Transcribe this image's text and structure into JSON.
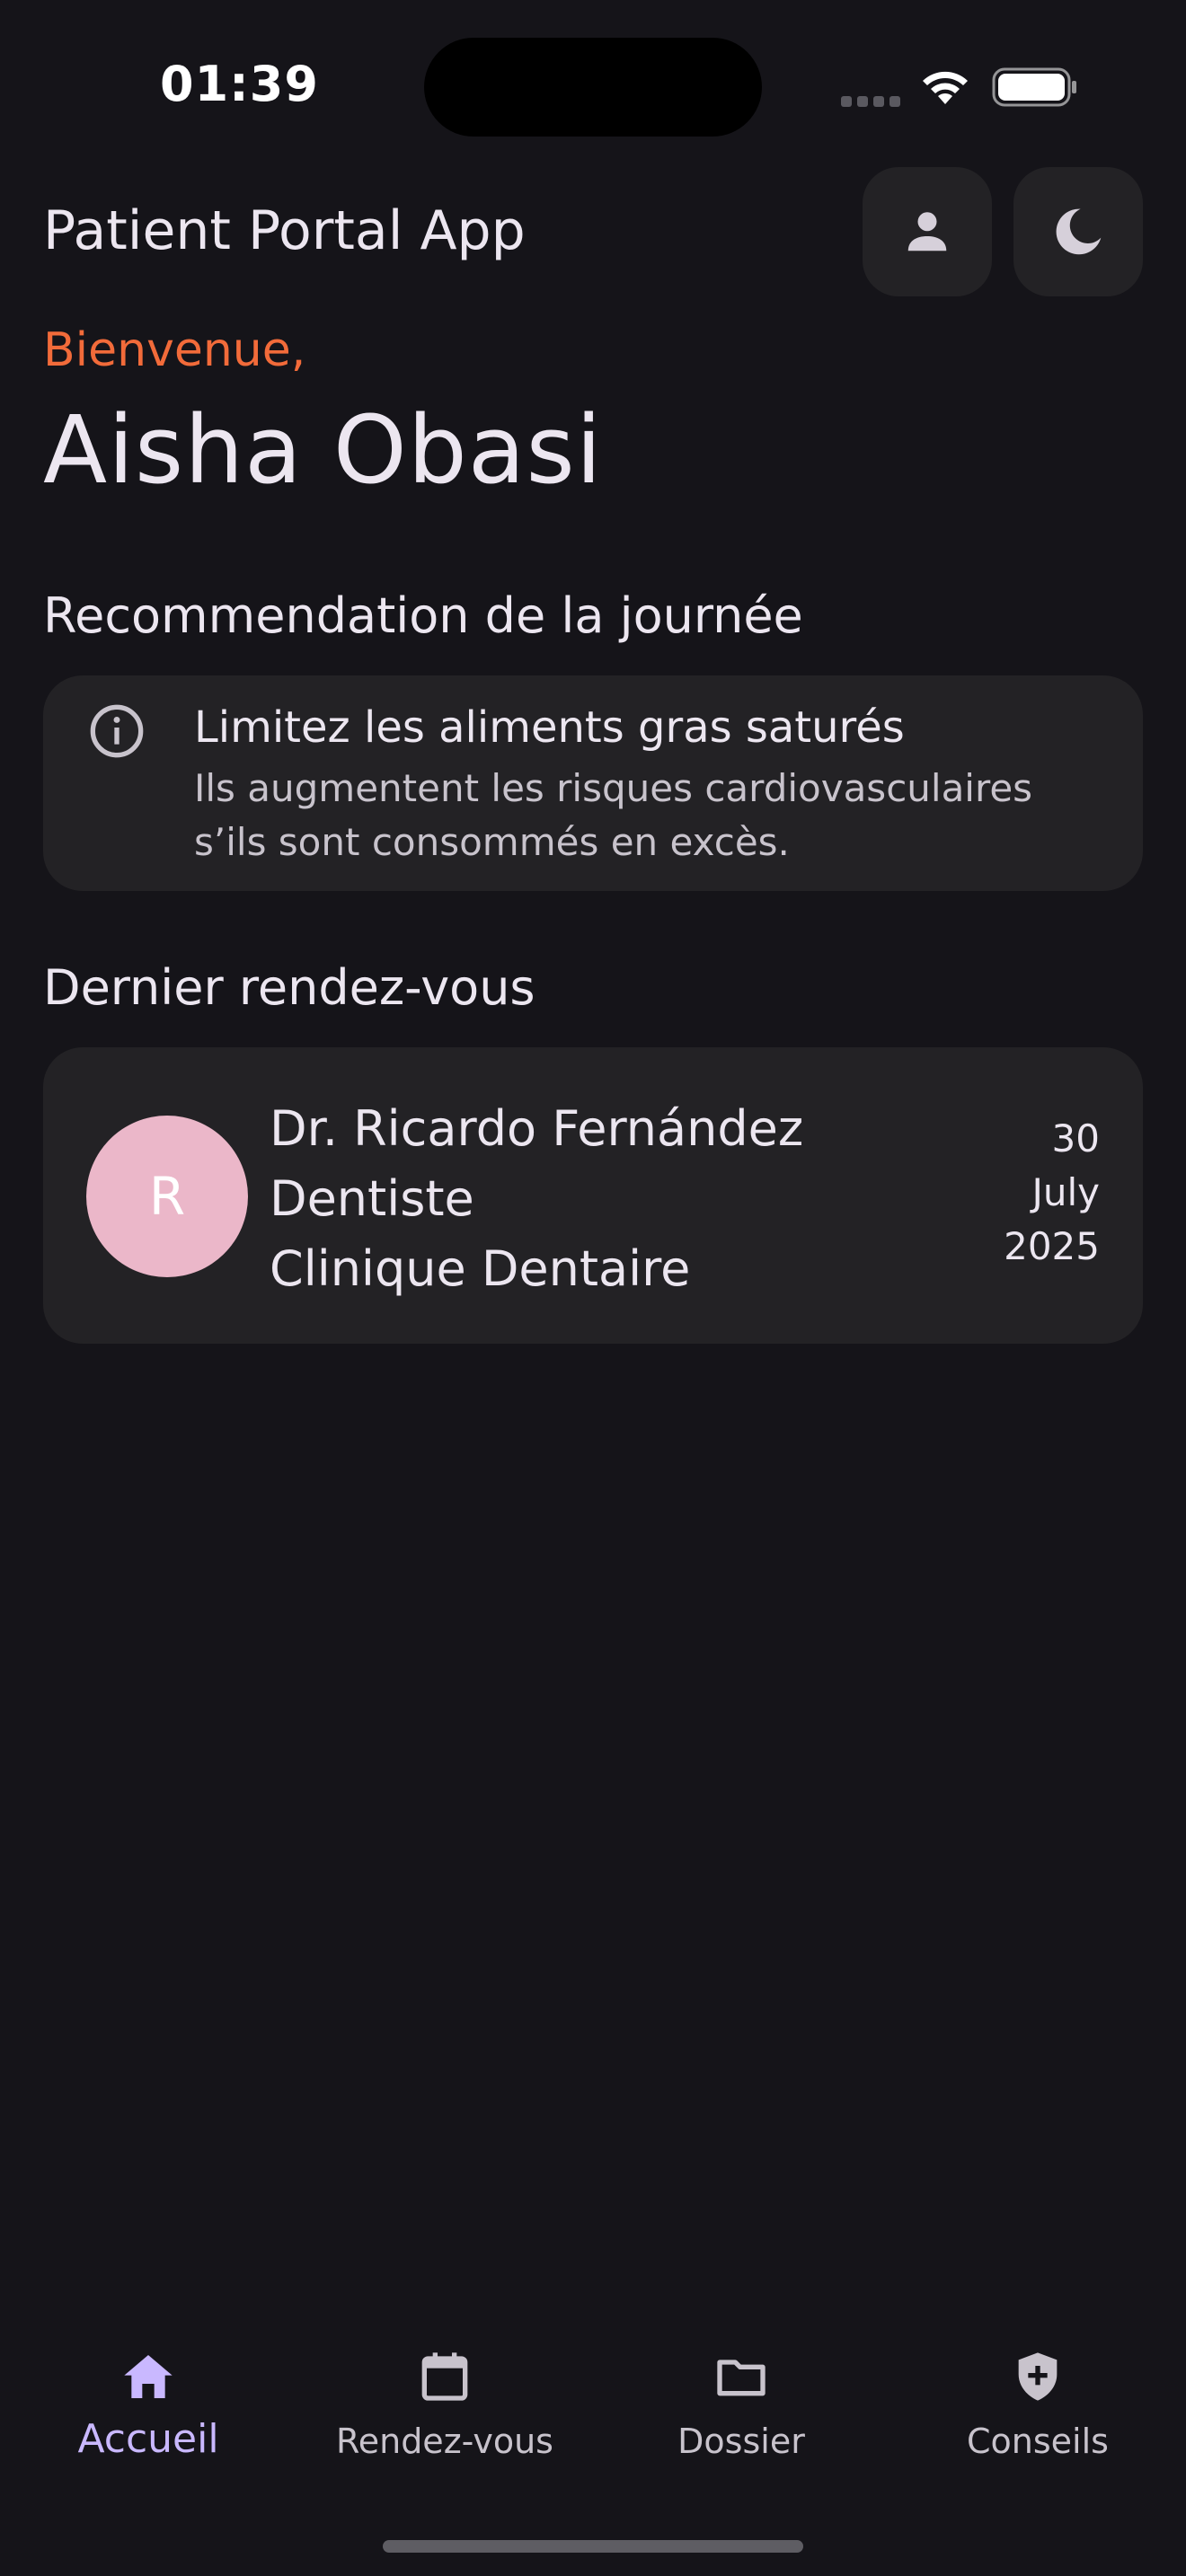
{
  "status_bar": {
    "time": "01:39"
  },
  "header": {
    "title": "Patient Portal App",
    "profile_icon": "person-icon",
    "theme_icon": "moon-icon"
  },
  "greeting": {
    "label": "Bienvenue,",
    "name": "Aisha Obasi"
  },
  "recommendation": {
    "section_title": "Recommendation de la journée",
    "icon": "info-icon",
    "title": "Limitez les aliments gras saturés",
    "text": "Ils augmentent les risques cardiovasculaires s’ils sont consommés en excès."
  },
  "last_appointment": {
    "section_title": "Dernier rendez-vous",
    "avatar_letter": "R",
    "doctor": "Dr. Ricardo Fernández",
    "specialty": "Dentiste",
    "clinic": "Clinique Dentaire",
    "date": {
      "day": "30",
      "month": "July",
      "year": "2025"
    }
  },
  "bottom_nav": {
    "items": [
      {
        "label": "Accueil",
        "icon": "home-icon",
        "active": true
      },
      {
        "label": "Rendez-vous",
        "icon": "calendar-icon",
        "active": false
      },
      {
        "label": "Dossier",
        "icon": "folder-icon",
        "active": false
      },
      {
        "label": "Conseils",
        "icon": "shield-plus-icon",
        "active": false
      }
    ]
  },
  "colors": {
    "background": "#151419",
    "card": "#232225",
    "accent_orange": "#F26B3A",
    "active_nav": "#C9B8FF",
    "avatar": "#EBB7C9"
  }
}
